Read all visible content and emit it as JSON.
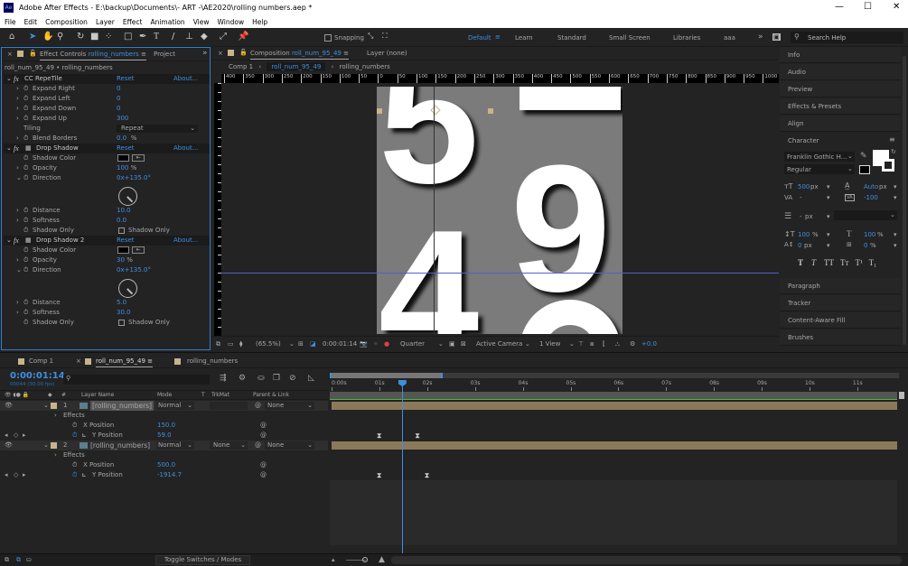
{
  "window": {
    "title": "Adobe After Effects - E:\\backup\\Documents\\- ART -\\AE2020\\rolling numbers.aep *",
    "icon": "ae-logo-icon",
    "controls": [
      "minimize-icon",
      "maximize-icon",
      "close-icon"
    ]
  },
  "menu": [
    "File",
    "Edit",
    "Composition",
    "Layer",
    "Effect",
    "Animation",
    "View",
    "Window",
    "Help"
  ],
  "toolbar": {
    "tools": [
      "home-icon",
      "selection-icon",
      "hand-icon",
      "zoom-icon",
      "rotate-icon",
      "camera-icon",
      "pan-behind-icon",
      "rectangle-icon",
      "pen-icon",
      "type-icon",
      "brush-icon",
      "clone-stamp-icon",
      "eraser-icon",
      "roto-brush-icon",
      "puppet-pin-icon"
    ],
    "snapping": "Snapping",
    "snapping_checked": false
  },
  "workspaces": {
    "items": [
      "Default",
      "Learn",
      "Standard",
      "Small Screen",
      "Libraries",
      "aaa"
    ],
    "active": "Default"
  },
  "search_help": "Search Help",
  "effect_controls": {
    "tab_label": "Effect Controls",
    "tab_layer": "rolling_numbers",
    "project_tab": "Project",
    "breadcrumb": "roll_num_95_49 • rolling_numbers",
    "rows": [
      {
        "type": "header",
        "label": "CC RepeTile",
        "reset": "Reset",
        "about": "About..."
      },
      {
        "type": "prop",
        "label": "Expand Right",
        "value": "0"
      },
      {
        "type": "prop",
        "label": "Expand Left",
        "value": "0"
      },
      {
        "type": "prop",
        "label": "Expand Down",
        "value": "0"
      },
      {
        "type": "prop",
        "label": "Expand Up",
        "value": "300"
      },
      {
        "type": "dropdown",
        "label": "Tiling",
        "value": "Repeat"
      },
      {
        "type": "prop",
        "label": "Blend Borders",
        "value": "0.0",
        "unit": "%"
      },
      {
        "type": "header",
        "label": "Drop Shadow",
        "reset": "Reset",
        "about": "About..."
      },
      {
        "type": "color",
        "label": "Shadow Color",
        "value": "#000000"
      },
      {
        "type": "prop",
        "label": "Opacity",
        "value": "100",
        "unit": "%"
      },
      {
        "type": "angle",
        "label": "Direction",
        "value": "0x+135.0°"
      },
      {
        "type": "prop",
        "label": "Distance",
        "value": "10.0"
      },
      {
        "type": "prop",
        "label": "Softness",
        "value": "0.0"
      },
      {
        "type": "checkbox",
        "label": "Shadow Only",
        "value": "Shadow Only",
        "checked": false
      },
      {
        "type": "header",
        "label": "Drop Shadow 2",
        "reset": "Reset",
        "about": "About..."
      },
      {
        "type": "color",
        "label": "Shadow Color",
        "value": "#000000"
      },
      {
        "type": "prop",
        "label": "Opacity",
        "value": "30",
        "unit": "%"
      },
      {
        "type": "angle",
        "label": "Direction",
        "value": "0x+135.0°"
      },
      {
        "type": "prop",
        "label": "Distance",
        "value": "5.0"
      },
      {
        "type": "prop",
        "label": "Softness",
        "value": "30.0"
      },
      {
        "type": "checkbox",
        "label": "Shadow Only",
        "value": "Shadow Only",
        "checked": false
      }
    ]
  },
  "composition": {
    "tab_label": "Composition",
    "tab_comp": "roll_num_95_49",
    "layer_tab": "Layer (none)",
    "nav": [
      "Comp 1",
      "roll_num_95_49",
      "rolling_numbers"
    ],
    "ruler": [
      "400",
      "350",
      "300",
      "250",
      "200",
      "150",
      "100",
      "50",
      "0",
      "50",
      "100",
      "150",
      "200",
      "250",
      "300",
      "350",
      "400",
      "450",
      "500",
      "550",
      "600",
      "650",
      "700",
      "750",
      "800",
      "850",
      "900",
      "950",
      "1000"
    ],
    "digits": [
      "5",
      "9",
      "4"
    ],
    "footer": {
      "zoom": "(65.5%)",
      "time": "0:00:01:14",
      "resolution": "Quarter",
      "camera": "Active Camera",
      "views": "1 View",
      "exposure": "+0.0"
    }
  },
  "right_panels": {
    "top": [
      "Info",
      "Audio",
      "Preview",
      "Effects & Presets",
      "Align"
    ],
    "bottom": [
      "Paragraph",
      "Tracker",
      "Content-Aware Fill",
      "Brushes"
    ]
  },
  "character": {
    "title": "Character",
    "font": "Franklin Gothic H...",
    "style": "Regular",
    "size": "500",
    "size_unit": "px",
    "leading": "Auto",
    "leading_unit": "px",
    "kerning": "-",
    "tracking": "-100",
    "stroke": "-",
    "stroke_unit": "px",
    "v_scale": "100",
    "h_scale": "100",
    "pct": "%",
    "baseline": "0",
    "baseline_unit": "px",
    "tsume": "0",
    "fill_color": "#ffffff",
    "styles": [
      "T",
      "T",
      "TT",
      "Tт",
      "T¹",
      "T₁"
    ]
  },
  "timeline": {
    "tabs": [
      "Comp 1",
      "roll_num_95_49",
      "rolling_numbers"
    ],
    "active_tab": "roll_num_95_49",
    "time": "0:00:01:14",
    "frames": "00044 (30.00 fps)",
    "columns": {
      "num": "#",
      "name": "Layer Name",
      "mode": "Mode",
      "t": "T",
      "trkmat": "TrkMat",
      "parent": "Parent & Link"
    },
    "ruler": [
      "0:00s",
      "01s",
      "02s",
      "03s",
      "04s",
      "05s",
      "06s",
      "07s",
      "08s",
      "09s",
      "10s",
      "11s"
    ],
    "current_time_s": 1.47,
    "layers": [
      {
        "num": "1",
        "name": "[rolling_numbers]",
        "mode": "Normal",
        "trkmat": "",
        "parent": "None",
        "effects": "Effects",
        "props": [
          {
            "label": "X Position",
            "value": "150.0",
            "keys": []
          },
          {
            "label": "Y Position",
            "value": "59.0",
            "keys": [
              1.0,
              1.8
            ]
          }
        ]
      },
      {
        "num": "2",
        "name": "[rolling_numbers]",
        "mode": "Normal",
        "trkmat": "None",
        "parent": "None",
        "effects": "Effects",
        "props": [
          {
            "label": "X Position",
            "value": "500.0",
            "keys": []
          },
          {
            "label": "Y Position",
            "value": "-1914.7",
            "keys": [
              1.0,
              2.0
            ]
          }
        ]
      }
    ],
    "label_color": "#c8b48c",
    "toggle": "Toggle Switches / Modes"
  }
}
